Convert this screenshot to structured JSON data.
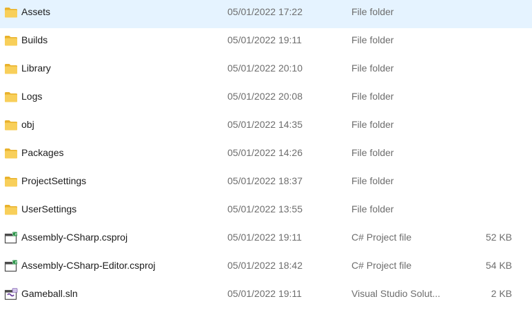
{
  "colors": {
    "folder": "#f8cf5a",
    "folder_dark": "#e9b22c",
    "secondary_text": "#6d6d6d",
    "csproj_accent": "#1e8e3e",
    "sln_accent": "#6b3fa0"
  },
  "files": [
    {
      "name": "Assets",
      "date": "05/01/2022 17:22",
      "type": "File folder",
      "size": "",
      "icon": "folder-icon"
    },
    {
      "name": "Builds",
      "date": "05/01/2022 19:11",
      "type": "File folder",
      "size": "",
      "icon": "folder-icon"
    },
    {
      "name": "Library",
      "date": "05/01/2022 20:10",
      "type": "File folder",
      "size": "",
      "icon": "folder-icon"
    },
    {
      "name": "Logs",
      "date": "05/01/2022 20:08",
      "type": "File folder",
      "size": "",
      "icon": "folder-icon"
    },
    {
      "name": "obj",
      "date": "05/01/2022 14:35",
      "type": "File folder",
      "size": "",
      "icon": "folder-icon"
    },
    {
      "name": "Packages",
      "date": "05/01/2022 14:26",
      "type": "File folder",
      "size": "",
      "icon": "folder-icon"
    },
    {
      "name": "ProjectSettings",
      "date": "05/01/2022 18:37",
      "type": "File folder",
      "size": "",
      "icon": "folder-icon"
    },
    {
      "name": "UserSettings",
      "date": "05/01/2022 13:55",
      "type": "File folder",
      "size": "",
      "icon": "folder-icon"
    },
    {
      "name": "Assembly-CSharp.csproj",
      "date": "05/01/2022 19:11",
      "type": "C# Project file",
      "size": "52 KB",
      "icon": "csproj-file-icon"
    },
    {
      "name": "Assembly-CSharp-Editor.csproj",
      "date": "05/01/2022 18:42",
      "type": "C# Project file",
      "size": "54 KB",
      "icon": "csproj-file-icon"
    },
    {
      "name": "Gameball.sln",
      "date": "05/01/2022 19:11",
      "type": "Visual Studio Solut...",
      "size": "2 KB",
      "icon": "sln-file-icon"
    }
  ]
}
